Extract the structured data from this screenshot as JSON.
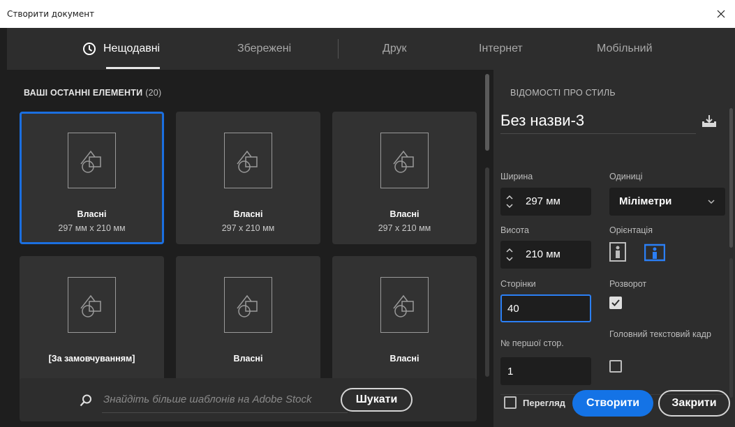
{
  "window": {
    "title": "Створити документ"
  },
  "tabs": [
    {
      "label": "Нещодавні",
      "active": true,
      "icon": "clock-icon"
    },
    {
      "label": "Збережені"
    },
    {
      "label": "Друк"
    },
    {
      "label": "Інтернет"
    },
    {
      "label": "Мобільний"
    }
  ],
  "recent": {
    "title": "ВАШІ ОСТАННІ ЕЛЕМЕНТИ",
    "count": "(20)",
    "items": [
      {
        "name": "Власні",
        "dims": "297 мм x 210 мм",
        "selected": true
      },
      {
        "name": "Власні",
        "dims": "297 x 210 мм"
      },
      {
        "name": "Власні",
        "dims": "297 x 210 мм"
      },
      {
        "name": "[За замовчуванням]",
        "dims": ""
      },
      {
        "name": "Власні",
        "dims": ""
      },
      {
        "name": "Власні",
        "dims": ""
      }
    ]
  },
  "search": {
    "placeholder": "Знайдіть більше шаблонів на Adobe Stock",
    "button_label": "Шукати"
  },
  "details": {
    "heading": "ВІДОМОСТІ ПРО СТИЛЬ",
    "preset_name": "Без назви-3",
    "width_label": "Ширина",
    "width_value": "297 мм",
    "units_label": "Одиниці",
    "units_value": "Міліметри",
    "height_label": "Висота",
    "height_value": "210 мм",
    "orientation_label": "Орієнтація",
    "orientation_selected": "landscape",
    "pages_label": "Сторінки",
    "pages_value": "40",
    "facing_label": "Розворот",
    "facing_checked": true,
    "start_label": "№ першої стор.",
    "start_value": "1",
    "primary_frame_label": "Головний текстовий кадр",
    "primary_frame_checked": false
  },
  "footer": {
    "preview_label": "Перегляд",
    "create_label": "Створити",
    "close_label": "Закрити"
  },
  "colors": {
    "accent": "#1473e6",
    "selection": "#1b6fe0",
    "panel": "#2d2d2d",
    "background": "#1e1e1e"
  }
}
